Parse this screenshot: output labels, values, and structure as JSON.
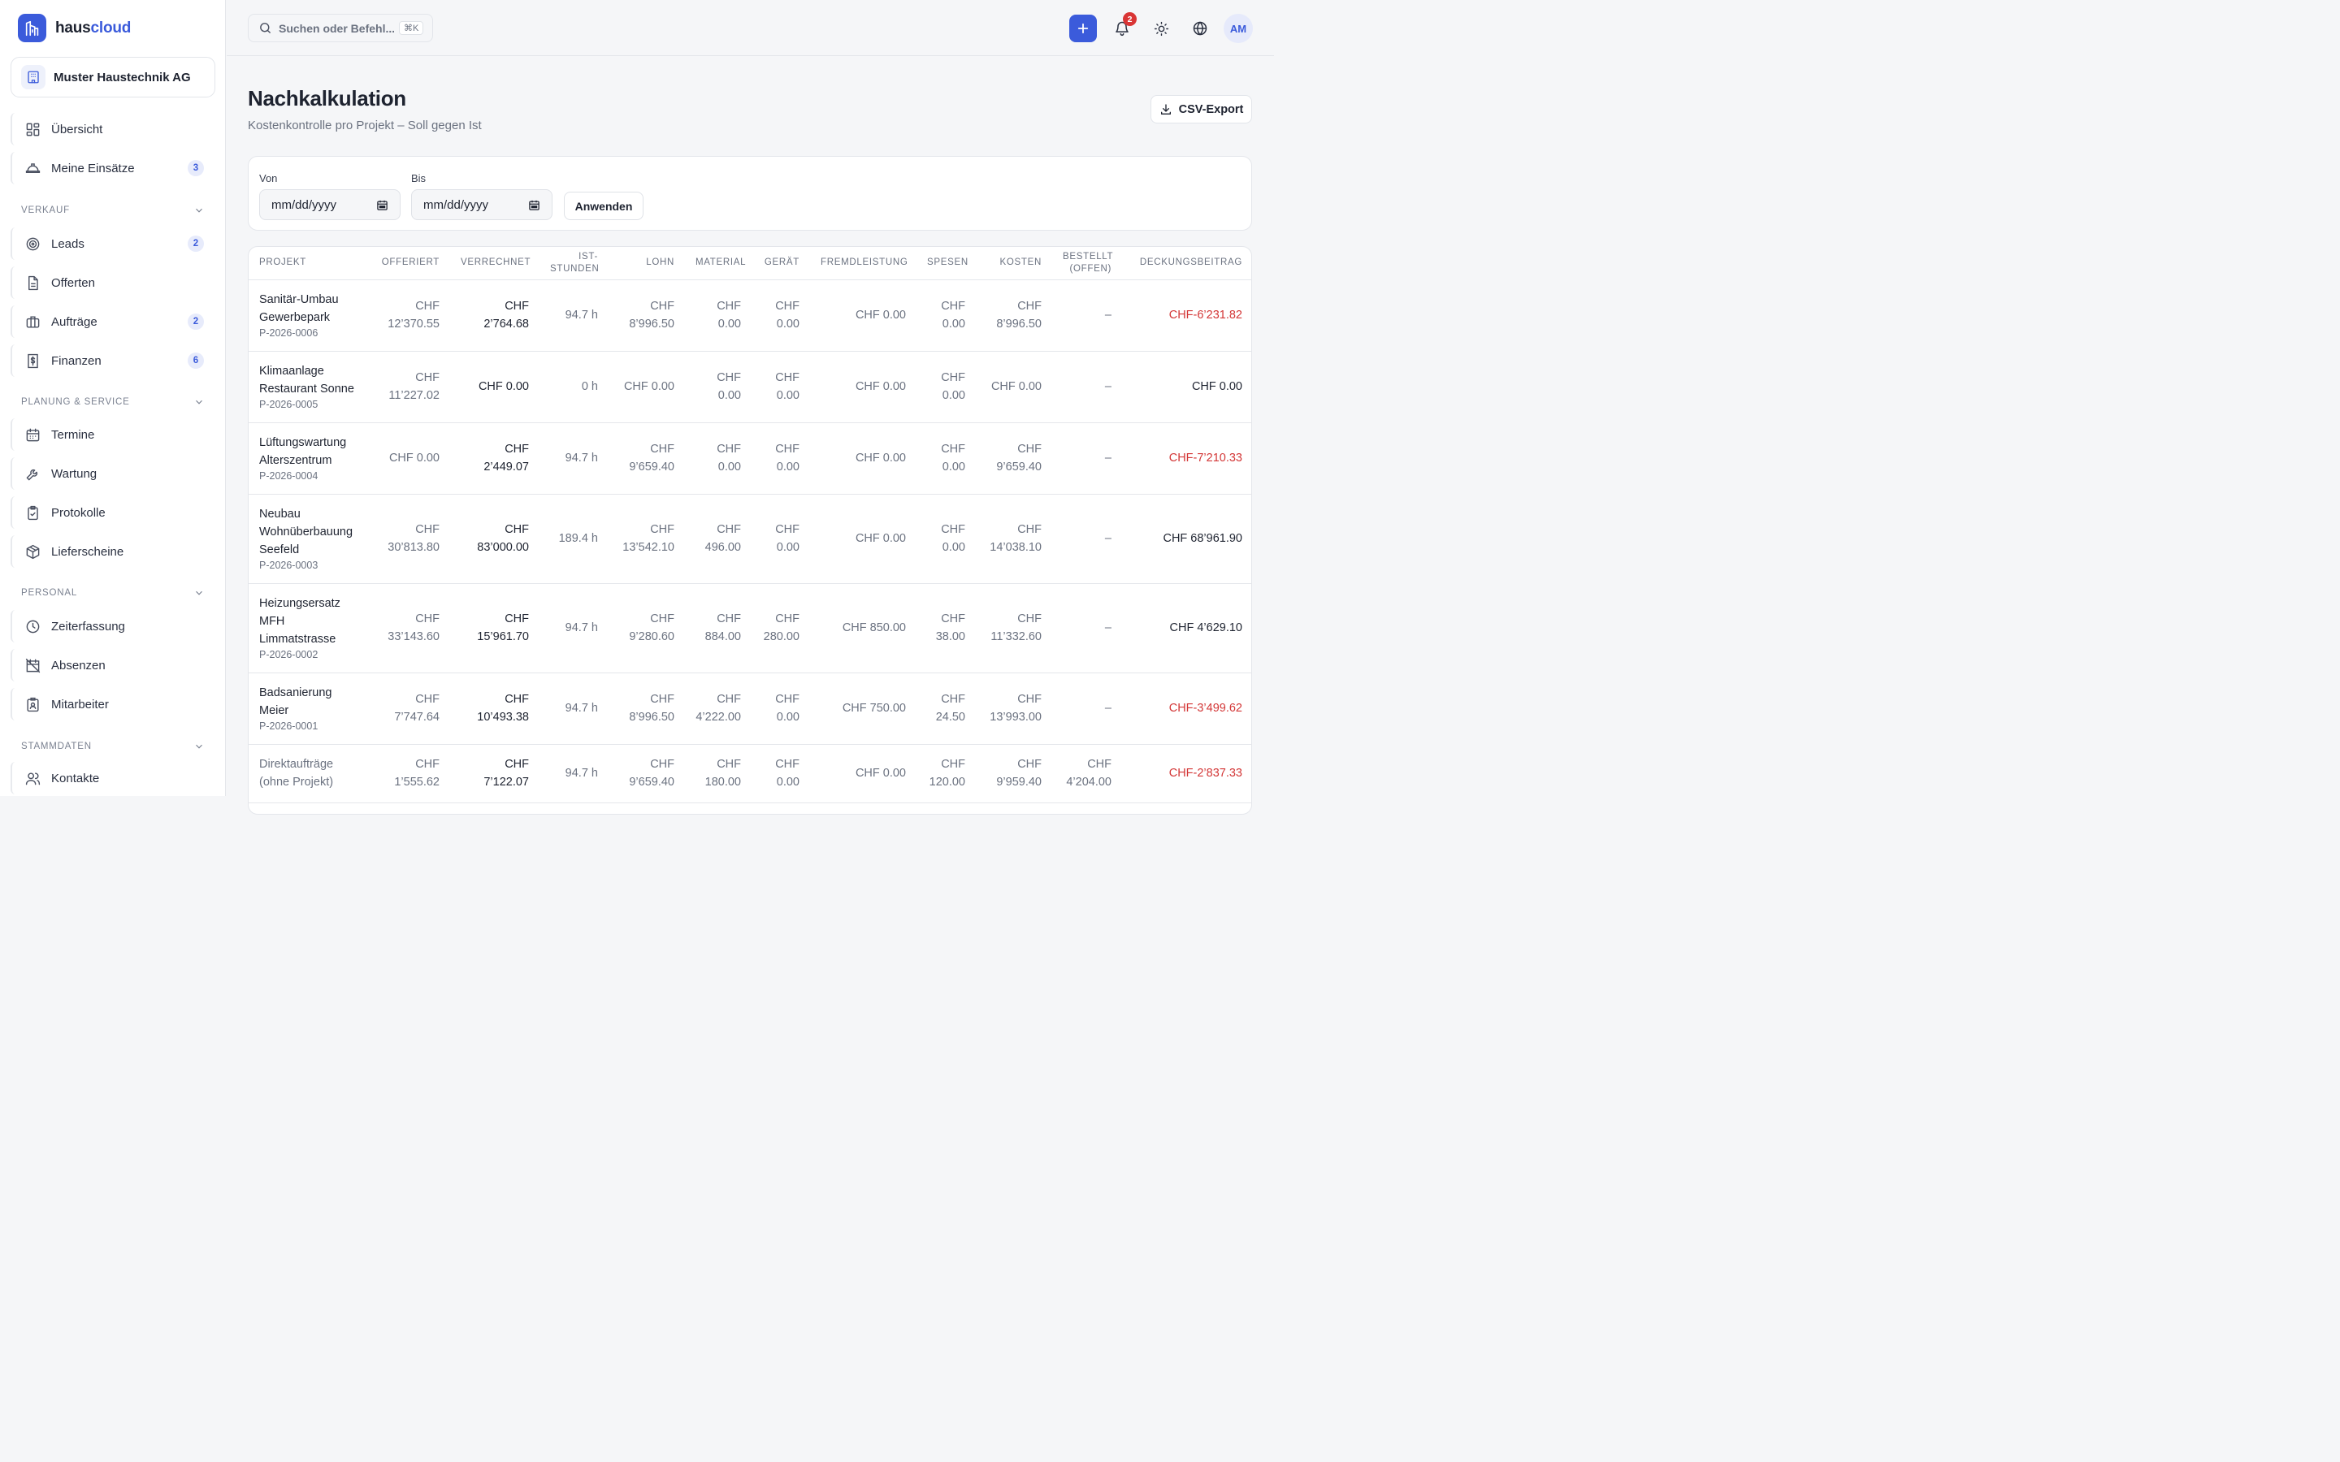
{
  "brand": {
    "name_part1": "haus",
    "name_part2": "cloud"
  },
  "company": {
    "name": "Muster Haustechnik AG"
  },
  "nav": {
    "top": [
      {
        "label": "Übersicht",
        "icon": "dashboard-icon"
      },
      {
        "label": "Meine Einsätze",
        "icon": "hardhat-icon",
        "badge": "3"
      }
    ],
    "sections": [
      {
        "title": "VERKAUF",
        "items": [
          {
            "label": "Leads",
            "icon": "target-icon",
            "badge": "2"
          },
          {
            "label": "Offerten",
            "icon": "document-icon"
          },
          {
            "label": "Aufträge",
            "icon": "briefcase-icon",
            "badge": "2"
          },
          {
            "label": "Finanzen",
            "icon": "dollar-icon",
            "badge": "6"
          }
        ]
      },
      {
        "title": "PLANUNG & SERVICE",
        "items": [
          {
            "label": "Termine",
            "icon": "calendar-icon"
          },
          {
            "label": "Wartung",
            "icon": "wrench-icon"
          },
          {
            "label": "Protokolle",
            "icon": "clipboard-icon"
          },
          {
            "label": "Lieferscheine",
            "icon": "package-icon"
          }
        ]
      },
      {
        "title": "PERSONAL",
        "items": [
          {
            "label": "Zeiterfassung",
            "icon": "clock-icon"
          },
          {
            "label": "Absenzen",
            "icon": "calendar-off-icon"
          },
          {
            "label": "Mitarbeiter",
            "icon": "badge-icon"
          }
        ]
      },
      {
        "title": "STAMMDATEN",
        "items": [
          {
            "label": "Kontakte",
            "icon": "users-icon"
          }
        ]
      }
    ]
  },
  "topbar": {
    "search_placeholder": "Suchen oder Befehl...",
    "shortcut": "⌘K",
    "notifications_count": "2",
    "avatar_initials": "AM"
  },
  "page": {
    "title": "Nachkalkulation",
    "subtitle": "Kostenkontrolle pro Projekt – Soll gegen Ist",
    "csv_label": "CSV-Export"
  },
  "filters": {
    "from_label": "Von",
    "to_label": "Bis",
    "from_placeholder": "mm/dd/yyyy",
    "to_placeholder": "mm/dd/yyyy",
    "apply_label": "Anwenden"
  },
  "table": {
    "headers": {
      "projekt": "PROJEKT",
      "offeriert": "OFFERIERT",
      "verrechnet": "VERRECHNET",
      "ist_stunden_1": "IST-",
      "ist_stunden_2": "STUNDEN",
      "lohn": "LOHN",
      "material": "MATERIAL",
      "geraet": "GERÄT",
      "fremdleistung": "FREMDLEISTUNG",
      "spesen": "SPESEN",
      "kosten": "KOSTEN",
      "bestellt_1": "BESTELLT",
      "bestellt_2": "(OFFEN)",
      "deckungsbeitrag": "DECKUNGSBEITRAG"
    },
    "rows": [
      {
        "name": "Sanitär-Umbau Gewerbepark",
        "number": "P-2026-0006",
        "offeriert": "CHF 12’370.55",
        "verrechnet": "CHF 2’764.68",
        "ist": "94.7 h",
        "lohn": "CHF 8’996.50",
        "material": "CHF 0.00",
        "geraet": "CHF 0.00",
        "fremd": "CHF 0.00",
        "spesen": "CHF 0.00",
        "kosten": "CHF 8’996.50",
        "bestellt": "–",
        "db": "CHF-6’231.82",
        "db_neg": true
      },
      {
        "name": "Klimaanlage Restaurant Sonne",
        "number": "P-2026-0005",
        "offeriert": "CHF 11’227.02",
        "verrechnet": "CHF 0.00",
        "ist": "0 h",
        "lohn": "CHF 0.00",
        "material": "CHF 0.00",
        "geraet": "CHF 0.00",
        "fremd": "CHF 0.00",
        "spesen": "CHF 0.00",
        "kosten": "CHF 0.00",
        "bestellt": "–",
        "db": "CHF 0.00",
        "db_neg": false
      },
      {
        "name": "Lüftungswartung Alterszentrum",
        "number": "P-2026-0004",
        "offeriert": "CHF 0.00",
        "verrechnet": "CHF 2’449.07",
        "ist": "94.7 h",
        "lohn": "CHF 9’659.40",
        "material": "CHF 0.00",
        "geraet": "CHF 0.00",
        "fremd": "CHF 0.00",
        "spesen": "CHF 0.00",
        "kosten": "CHF 9’659.40",
        "bestellt": "–",
        "db": "CHF-7’210.33",
        "db_neg": true
      },
      {
        "name": "Neubau Wohnüberbauung Seefeld",
        "number": "P-2026-0003",
        "offeriert": "CHF 30’813.80",
        "verrechnet": "CHF 83’000.00",
        "ist": "189.4 h",
        "lohn": "CHF 13’542.10",
        "material": "CHF 496.00",
        "geraet": "CHF 0.00",
        "fremd": "CHF 0.00",
        "spesen": "CHF 0.00",
        "kosten": "CHF 14’038.10",
        "bestellt": "–",
        "db": "CHF 68’961.90",
        "db_neg": false
      },
      {
        "name": "Heizungsersatz MFH Limmatstrasse",
        "number": "P-2026-0002",
        "offeriert": "CHF 33’143.60",
        "verrechnet": "CHF 15’961.70",
        "ist": "94.7 h",
        "lohn": "CHF 9’280.60",
        "material": "CHF 884.00",
        "geraet": "CHF 280.00",
        "fremd": "CHF 850.00",
        "spesen": "CHF 38.00",
        "kosten": "CHF 11’332.60",
        "bestellt": "–",
        "db": "CHF 4’629.10",
        "db_neg": false
      },
      {
        "name": "Badsanierung Meier",
        "number": "P-2026-0001",
        "offeriert": "CHF 7’747.64",
        "verrechnet": "CHF 10’493.38",
        "ist": "94.7 h",
        "lohn": "CHF 8’996.50",
        "material": "CHF 4’222.00",
        "geraet": "CHF 0.00",
        "fremd": "CHF 750.00",
        "spesen": "CHF 24.50",
        "kosten": "CHF 13’993.00",
        "bestellt": "–",
        "db": "CHF-3’499.62",
        "db_neg": true
      },
      {
        "name": "Direktaufträge (ohne Projekt)",
        "number": "",
        "offeriert": "CHF 1’555.62",
        "verrechnet": "CHF 7’122.07",
        "ist": "94.7 h",
        "lohn": "CHF 9’659.40",
        "material": "CHF 180.00",
        "geraet": "CHF 0.00",
        "fremd": "CHF 0.00",
        "spesen": "CHF 120.00",
        "kosten": "CHF 9’959.40",
        "bestellt": "CHF 4’204.00",
        "db": "CHF-2’837.33",
        "db_neg": true,
        "muted_name": true
      }
    ]
  }
}
